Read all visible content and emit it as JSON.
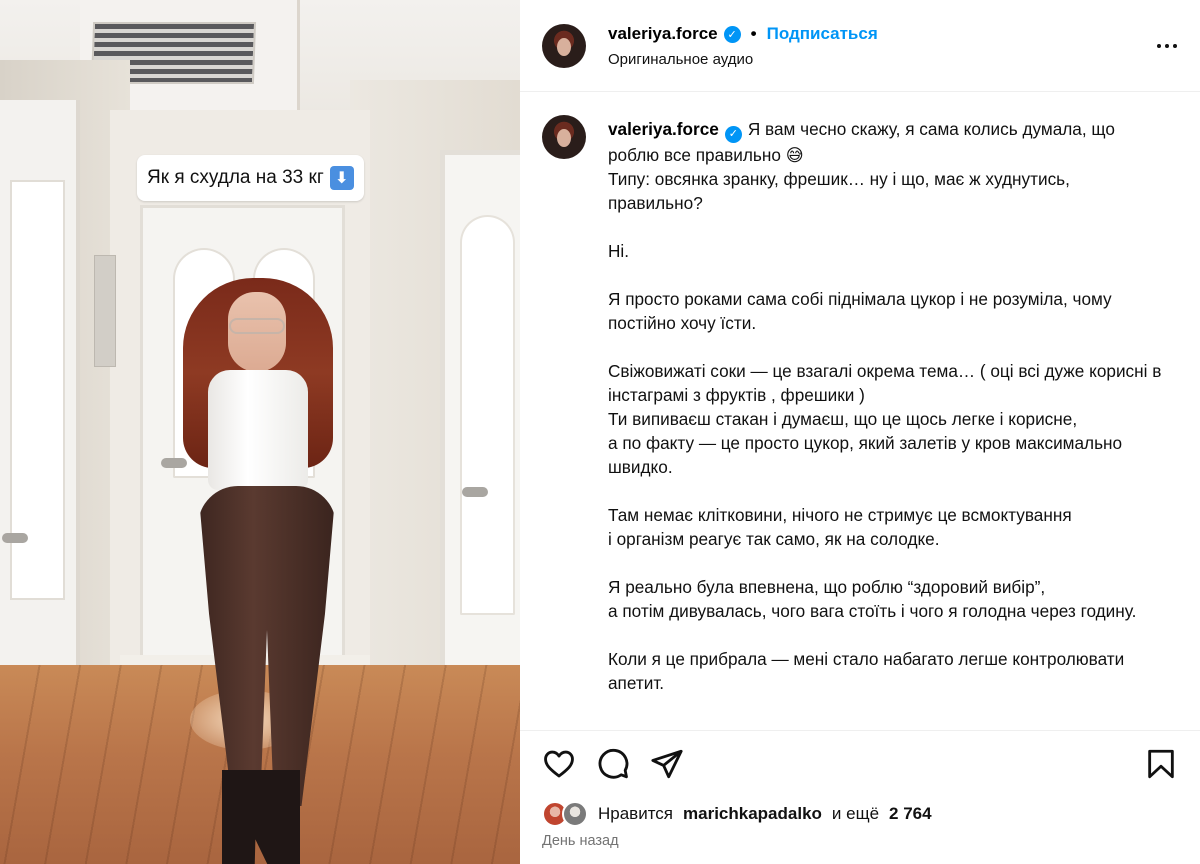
{
  "media": {
    "overlay_text": "Як я схудла на 33 кг",
    "overlay_arrow_icon": "arrow-down-emoji-icon",
    "overlay_arrow_glyph": "⬇",
    "accent_color": "#4a8fe0"
  },
  "header": {
    "username": "valeriya.force",
    "verified_glyph": "✓",
    "separator": "•",
    "follow_label": "Подписаться",
    "audio_label": "Оригинальное аудио",
    "more_icon": "more-horizontal-icon",
    "follow_color": "#0095f6"
  },
  "caption": {
    "username": "valeriya.force",
    "verified_glyph": "✓",
    "paragraphs": [
      "Я вам чесно скажу, я сама колись думала, що роблю все правильно 😅\nТипу: овсянка зранку, фрешик… ну і що, має ж худнутись, правильно?",
      "Ні.",
      "Я просто роками сама собі піднімала цукор і не розуміла, чому постійно хочу їсти.",
      "Свіжовижаті соки — це взагалі окрема тема… ( оці всі дуже корисні в інстаграмі з фруктів , фрешики )\nТи випиваєш стакан і думаєш, що це щось легке і корисне,\nа по факту — це просто цукор, який залетів у кров максимально швидко.",
      "Там немає клітковини, нічого не стримує це всмоктування\nі організм реагує так само, як на солодке.",
      "Я реально була впевнена, що роблю “здоровий вибір”,\nа потім дивувалась, чого вага стоїть і чого я голодна через годину.",
      "Коли я це прибрала — мені стало набагато легше контролювати апетит."
    ]
  },
  "actions": {
    "like_icon": "heart-icon",
    "comment_icon": "comment-icon",
    "share_icon": "share-icon",
    "save_icon": "bookmark-icon"
  },
  "likes": {
    "prefix": "Нравится",
    "user": "marichkapadalko",
    "middle": "и ещё",
    "count": "2 764"
  },
  "timestamp": "День назад"
}
